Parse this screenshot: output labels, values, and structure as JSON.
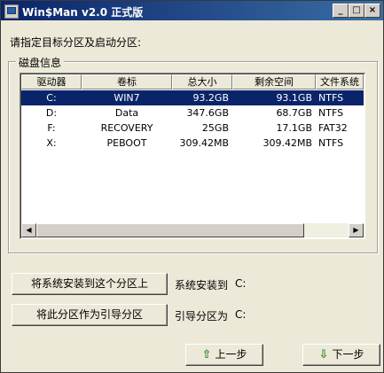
{
  "window": {
    "title": "Win$Man v2.0 正式版",
    "min_icon": "minimize-icon",
    "max_icon": "maximize-icon",
    "close_icon": "close-icon"
  },
  "prompt": "请指定目标分区及启动分区:",
  "group": {
    "title": "磁盘信息",
    "columns": [
      "驱动器",
      "卷标",
      "总大小",
      "剩余空间",
      "文件系统"
    ],
    "rows": [
      {
        "drive": "C:",
        "label": "WIN7",
        "total": "93.2GB",
        "free": "93.1GB",
        "fs": "NTFS",
        "selected": true
      },
      {
        "drive": "D:",
        "label": "Data",
        "total": "347.6GB",
        "free": "68.7GB",
        "fs": "NTFS",
        "selected": false
      },
      {
        "drive": "F:",
        "label": "RECOVERY",
        "total": "25GB",
        "free": "17.1GB",
        "fs": "FAT32",
        "selected": false
      },
      {
        "drive": "X:",
        "label": "PEBOOT",
        "total": "309.42MB",
        "free": "309.42MB",
        "fs": "NTFS",
        "selected": false
      }
    ]
  },
  "actions": {
    "install_label": "将系统安装到这个分区上",
    "install_info": "系统安装到",
    "install_value": "C:",
    "boot_label": "将此分区作为引导分区",
    "boot_info": "引导分区为",
    "boot_value": "C:"
  },
  "nav": {
    "prev_label": "上一步",
    "next_label": "下一步",
    "accent": "#2e8b2e"
  },
  "colors": {
    "title_start": "#0a246a",
    "title_end": "#3a6ea5",
    "selection": "#0a246a",
    "face": "#ece9d8"
  }
}
